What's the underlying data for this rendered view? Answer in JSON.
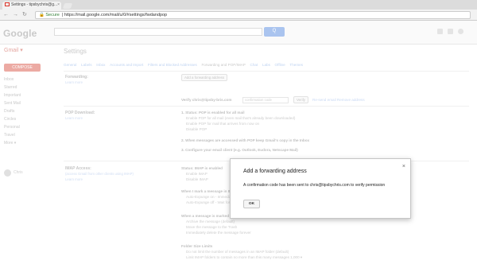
{
  "browser": {
    "tab_title": "Settings - tipsbychris@g...",
    "tab_close": "×",
    "back": "←",
    "forward": "→",
    "reload": "↻",
    "secure_label": "🔒 Secure",
    "url": "https://mail.google.com/mail/u/0/#settings/fwdandpop"
  },
  "gmail": {
    "logo": "Google",
    "search_button": "Q",
    "app_label": "Gmail ▾",
    "settings_title": "Settings",
    "compose": "COMPOSE",
    "sidebar": [
      "Inbox",
      "Starred",
      "Important",
      "Sent Mail",
      "Drafts",
      "Circles",
      "Personal",
      "Travel",
      "More ▾"
    ],
    "user": "Chris"
  },
  "settings_tabs": [
    "General",
    "Labels",
    "Inbox",
    "Accounts and Import",
    "Filters and Blocked Addresses",
    "Forwarding and POP/IMAP",
    "Chat",
    "Labs",
    "Offline",
    "Themes"
  ],
  "forwarding": {
    "heading": "Forwarding:",
    "sub": "Learn more",
    "add_button": "Add a forwarding address",
    "verify_label": "Verify chris@tipsby-bris.com",
    "code_placeholder": "confirmation code",
    "verify_button": "Verify",
    "resend_link": "Re-send email Remove address"
  },
  "pop": {
    "heading": "POP Download:",
    "sub": "Learn more",
    "status": "1. Status: POP is enabled for all mail",
    "opt1": "Enable POP for all mail (even mail that's already been downloaded)",
    "opt2": "Enable POP for mail that arrives from now on",
    "opt3": "Disable POP",
    "step2": "2. When messages are accessed with POP  keep Gmail's copy in the Inbox",
    "step3": "3. Configure your email client (e.g. Outlook, Eudora, Netscape Mail)"
  },
  "imap": {
    "heading": "IMAP Access:",
    "sub": "(access Gmail from other clients using IMAP)",
    "sub2": "Learn more",
    "status": "Status: IMAP is enabled",
    "enable": "Enable IMAP",
    "disable": "Disable IMAP",
    "when_deleted": "When I mark a message in IMAP as deleted:",
    "auto_on": "Auto-Expunge on - Immediately update the server. (default)",
    "auto_off": "Auto-Expunge off - Wait for the client to update the server.",
    "when_expunged": "When a message is marked as deleted and expunged from the last visible IMAP folder:",
    "archive": "Archive the message (default)",
    "trash": "Move the message to the Trash",
    "delete": "Immediately delete the message forever",
    "folder_limits": "Folder Size Limits",
    "limit1": "Do not limit the number of messages in an IMAP folder (default)",
    "limit2": "Limit IMAP folders to contain no more than this many messages  1,000 ▾"
  },
  "dialog": {
    "title": "Add a forwarding address",
    "close": "×",
    "message": "A confirmation code has been sent to chris@tipsbychris.com to verify permission",
    "ok": "OK"
  }
}
